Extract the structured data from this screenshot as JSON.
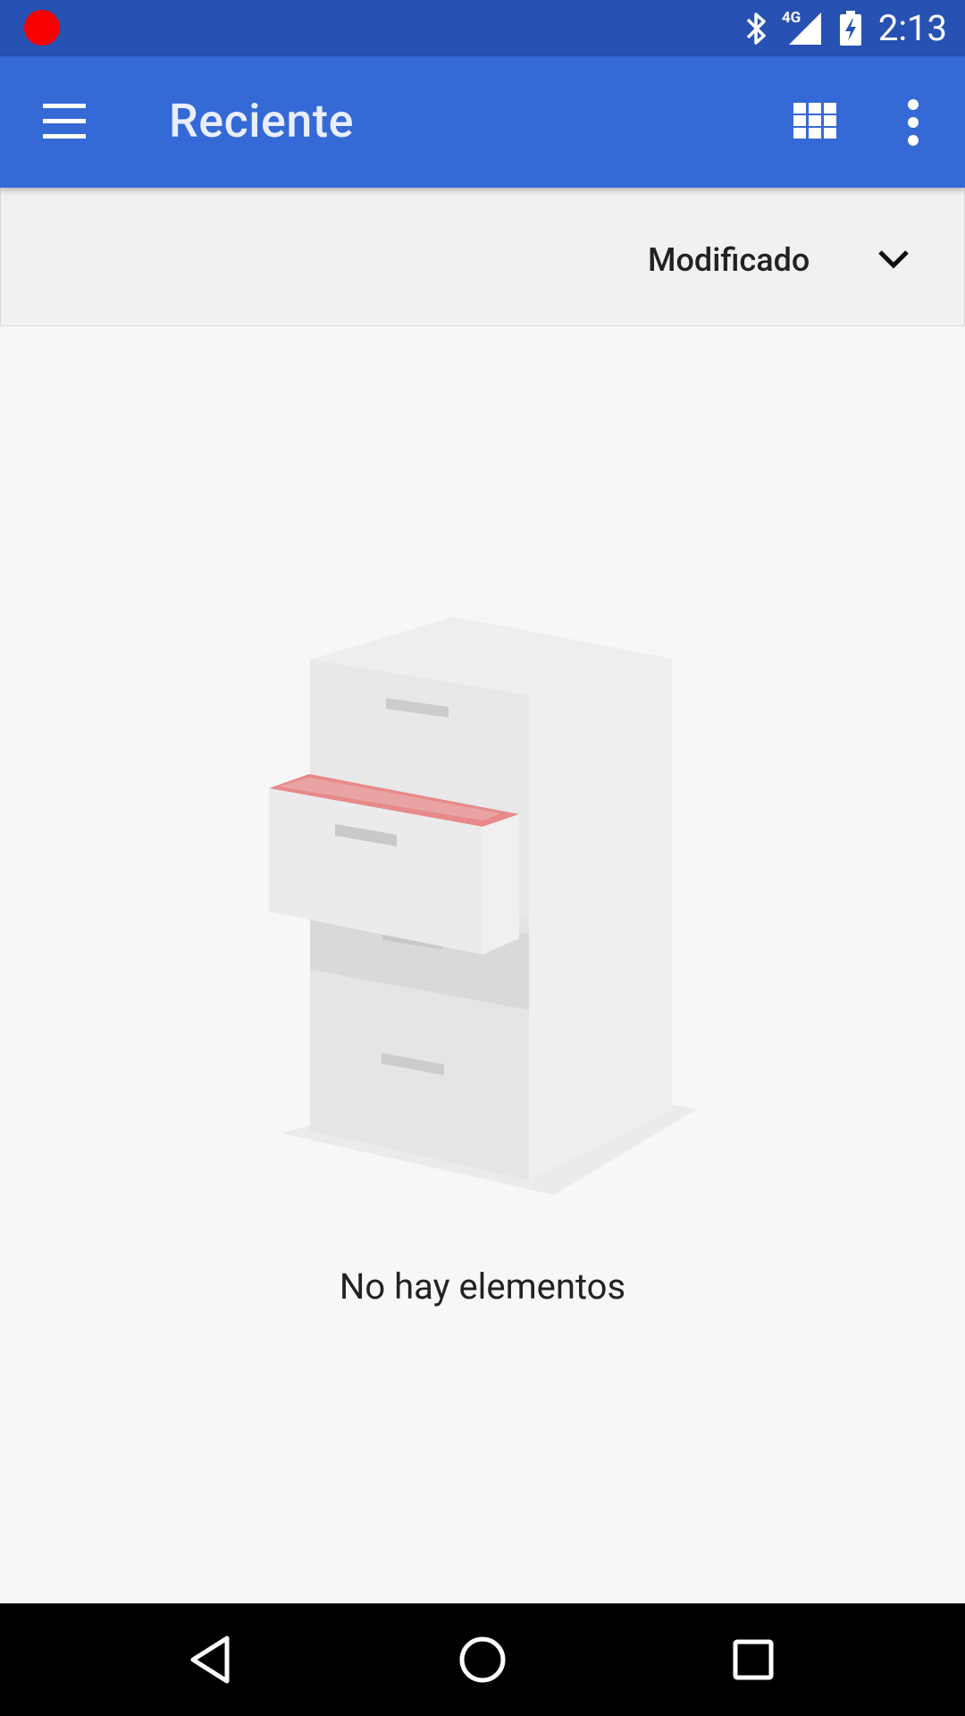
{
  "status_bar": {
    "time": "2:13",
    "network": "4G",
    "icons": [
      "recording-indicator-icon",
      "bluetooth-icon",
      "signal-icon",
      "battery-charging-icon"
    ]
  },
  "app_bar": {
    "title": "Reciente",
    "icons": [
      "menu-icon",
      "grid-view-icon",
      "more-vert-icon"
    ]
  },
  "sort_bar": {
    "label": "Modificado",
    "icon": "chevron-down-icon"
  },
  "empty_state": {
    "message": "No hay elementos",
    "illustration": "filing-cabinet-illustration"
  },
  "nav_bar": {
    "icons": [
      "back-icon",
      "home-icon",
      "recents-icon"
    ]
  },
  "colors": {
    "status_bar": "#2752b3",
    "app_bar": "#3569d6",
    "background": "#f7f7f7",
    "accent_drawer": "#e88a8a"
  }
}
